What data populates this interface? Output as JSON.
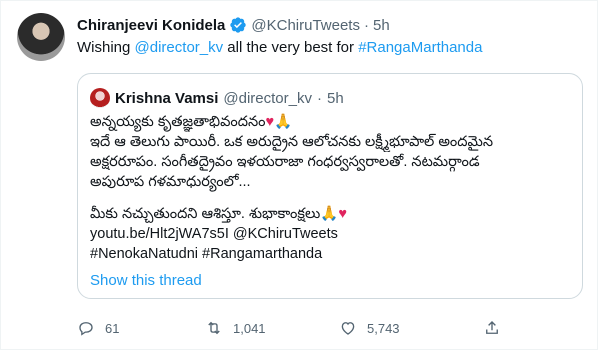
{
  "tweet": {
    "author_name": "Chiranjeevi Konidela",
    "author_handle": "@KChiruTweets",
    "separator": "·",
    "time": "5h",
    "text_prefix": "Wishing ",
    "mention": "@director_kv",
    "text_middle": " all the very best for ",
    "hashtag": "#RangaMarthanda"
  },
  "quote": {
    "author_name": "Krishna Vamsi",
    "author_handle": "@director_kv",
    "separator": "·",
    "time": "5h",
    "lines": [
      "అన్నయ్యకు కృతజ్ఞతాభివందనం",
      "ఇదే ఆ తెలుగు పాయిరీ. ఒక అరుద్రైన ఆలోచనకు లక్ష్మీభూపాల్ అందమైన",
      "అక్షరరూపం. సంగీతద్రైవం ఇళయరాజా గంధర్వస్వరాలతో. నటమర్గాండ",
      "అపురూప గళమాధుర్యంలో...",
      "మీకు నచ్చుతుందని ఆశిస్తూ. శుభాకాంక్షలు",
      "youtu.be/Hlt2jWA7s5I @KChiruTweets",
      "#NenokaNatudni #Rangamarthanda"
    ],
    "heart": "♥",
    "pray": "🙏",
    "show_thread": "Show this thread"
  },
  "actions": {
    "replies": "61",
    "retweets": "1,041",
    "likes": "5,743"
  },
  "colors": {
    "link": "#1d9bf0",
    "verified": "#1d9bf0",
    "muted": "#536471",
    "border": "#cfd9de",
    "heart": "#e0245e"
  },
  "icons": [
    "verified-badge-icon",
    "reply-icon",
    "retweet-icon",
    "like-icon",
    "share-icon"
  ]
}
